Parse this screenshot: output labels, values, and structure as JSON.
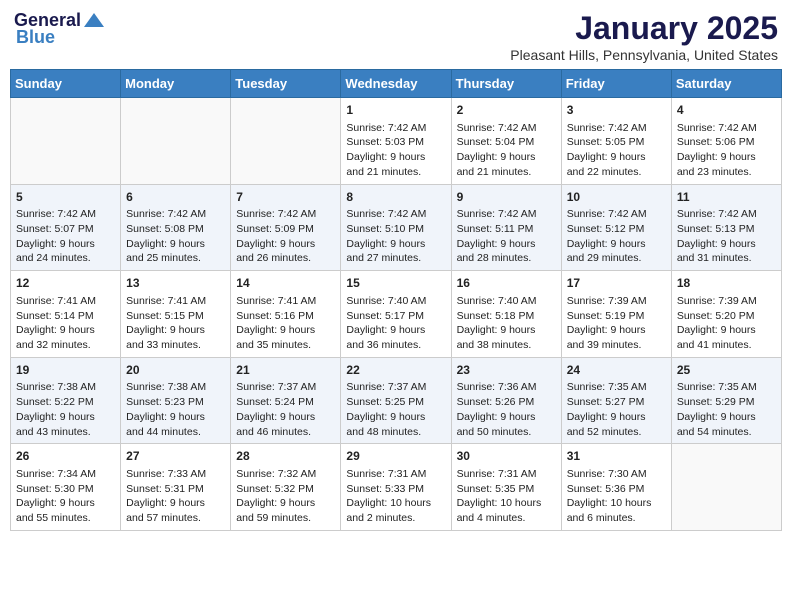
{
  "header": {
    "logo_general": "General",
    "logo_blue": "Blue",
    "title": "January 2025",
    "subtitle": "Pleasant Hills, Pennsylvania, United States"
  },
  "days_of_week": [
    "Sunday",
    "Monday",
    "Tuesday",
    "Wednesday",
    "Thursday",
    "Friday",
    "Saturday"
  ],
  "weeks": [
    [
      {
        "day": "",
        "sunrise": "",
        "sunset": "",
        "daylight": ""
      },
      {
        "day": "",
        "sunrise": "",
        "sunset": "",
        "daylight": ""
      },
      {
        "day": "",
        "sunrise": "",
        "sunset": "",
        "daylight": ""
      },
      {
        "day": "1",
        "sunrise": "Sunrise: 7:42 AM",
        "sunset": "Sunset: 5:03 PM",
        "daylight": "Daylight: 9 hours and 21 minutes."
      },
      {
        "day": "2",
        "sunrise": "Sunrise: 7:42 AM",
        "sunset": "Sunset: 5:04 PM",
        "daylight": "Daylight: 9 hours and 21 minutes."
      },
      {
        "day": "3",
        "sunrise": "Sunrise: 7:42 AM",
        "sunset": "Sunset: 5:05 PM",
        "daylight": "Daylight: 9 hours and 22 minutes."
      },
      {
        "day": "4",
        "sunrise": "Sunrise: 7:42 AM",
        "sunset": "Sunset: 5:06 PM",
        "daylight": "Daylight: 9 hours and 23 minutes."
      }
    ],
    [
      {
        "day": "5",
        "sunrise": "Sunrise: 7:42 AM",
        "sunset": "Sunset: 5:07 PM",
        "daylight": "Daylight: 9 hours and 24 minutes."
      },
      {
        "day": "6",
        "sunrise": "Sunrise: 7:42 AM",
        "sunset": "Sunset: 5:08 PM",
        "daylight": "Daylight: 9 hours and 25 minutes."
      },
      {
        "day": "7",
        "sunrise": "Sunrise: 7:42 AM",
        "sunset": "Sunset: 5:09 PM",
        "daylight": "Daylight: 9 hours and 26 minutes."
      },
      {
        "day": "8",
        "sunrise": "Sunrise: 7:42 AM",
        "sunset": "Sunset: 5:10 PM",
        "daylight": "Daylight: 9 hours and 27 minutes."
      },
      {
        "day": "9",
        "sunrise": "Sunrise: 7:42 AM",
        "sunset": "Sunset: 5:11 PM",
        "daylight": "Daylight: 9 hours and 28 minutes."
      },
      {
        "day": "10",
        "sunrise": "Sunrise: 7:42 AM",
        "sunset": "Sunset: 5:12 PM",
        "daylight": "Daylight: 9 hours and 29 minutes."
      },
      {
        "day": "11",
        "sunrise": "Sunrise: 7:42 AM",
        "sunset": "Sunset: 5:13 PM",
        "daylight": "Daylight: 9 hours and 31 minutes."
      }
    ],
    [
      {
        "day": "12",
        "sunrise": "Sunrise: 7:41 AM",
        "sunset": "Sunset: 5:14 PM",
        "daylight": "Daylight: 9 hours and 32 minutes."
      },
      {
        "day": "13",
        "sunrise": "Sunrise: 7:41 AM",
        "sunset": "Sunset: 5:15 PM",
        "daylight": "Daylight: 9 hours and 33 minutes."
      },
      {
        "day": "14",
        "sunrise": "Sunrise: 7:41 AM",
        "sunset": "Sunset: 5:16 PM",
        "daylight": "Daylight: 9 hours and 35 minutes."
      },
      {
        "day": "15",
        "sunrise": "Sunrise: 7:40 AM",
        "sunset": "Sunset: 5:17 PM",
        "daylight": "Daylight: 9 hours and 36 minutes."
      },
      {
        "day": "16",
        "sunrise": "Sunrise: 7:40 AM",
        "sunset": "Sunset: 5:18 PM",
        "daylight": "Daylight: 9 hours and 38 minutes."
      },
      {
        "day": "17",
        "sunrise": "Sunrise: 7:39 AM",
        "sunset": "Sunset: 5:19 PM",
        "daylight": "Daylight: 9 hours and 39 minutes."
      },
      {
        "day": "18",
        "sunrise": "Sunrise: 7:39 AM",
        "sunset": "Sunset: 5:20 PM",
        "daylight": "Daylight: 9 hours and 41 minutes."
      }
    ],
    [
      {
        "day": "19",
        "sunrise": "Sunrise: 7:38 AM",
        "sunset": "Sunset: 5:22 PM",
        "daylight": "Daylight: 9 hours and 43 minutes."
      },
      {
        "day": "20",
        "sunrise": "Sunrise: 7:38 AM",
        "sunset": "Sunset: 5:23 PM",
        "daylight": "Daylight: 9 hours and 44 minutes."
      },
      {
        "day": "21",
        "sunrise": "Sunrise: 7:37 AM",
        "sunset": "Sunset: 5:24 PM",
        "daylight": "Daylight: 9 hours and 46 minutes."
      },
      {
        "day": "22",
        "sunrise": "Sunrise: 7:37 AM",
        "sunset": "Sunset: 5:25 PM",
        "daylight": "Daylight: 9 hours and 48 minutes."
      },
      {
        "day": "23",
        "sunrise": "Sunrise: 7:36 AM",
        "sunset": "Sunset: 5:26 PM",
        "daylight": "Daylight: 9 hours and 50 minutes."
      },
      {
        "day": "24",
        "sunrise": "Sunrise: 7:35 AM",
        "sunset": "Sunset: 5:27 PM",
        "daylight": "Daylight: 9 hours and 52 minutes."
      },
      {
        "day": "25",
        "sunrise": "Sunrise: 7:35 AM",
        "sunset": "Sunset: 5:29 PM",
        "daylight": "Daylight: 9 hours and 54 minutes."
      }
    ],
    [
      {
        "day": "26",
        "sunrise": "Sunrise: 7:34 AM",
        "sunset": "Sunset: 5:30 PM",
        "daylight": "Daylight: 9 hours and 55 minutes."
      },
      {
        "day": "27",
        "sunrise": "Sunrise: 7:33 AM",
        "sunset": "Sunset: 5:31 PM",
        "daylight": "Daylight: 9 hours and 57 minutes."
      },
      {
        "day": "28",
        "sunrise": "Sunrise: 7:32 AM",
        "sunset": "Sunset: 5:32 PM",
        "daylight": "Daylight: 9 hours and 59 minutes."
      },
      {
        "day": "29",
        "sunrise": "Sunrise: 7:31 AM",
        "sunset": "Sunset: 5:33 PM",
        "daylight": "Daylight: 10 hours and 2 minutes."
      },
      {
        "day": "30",
        "sunrise": "Sunrise: 7:31 AM",
        "sunset": "Sunset: 5:35 PM",
        "daylight": "Daylight: 10 hours and 4 minutes."
      },
      {
        "day": "31",
        "sunrise": "Sunrise: 7:30 AM",
        "sunset": "Sunset: 5:36 PM",
        "daylight": "Daylight: 10 hours and 6 minutes."
      },
      {
        "day": "",
        "sunrise": "",
        "sunset": "",
        "daylight": ""
      }
    ]
  ]
}
